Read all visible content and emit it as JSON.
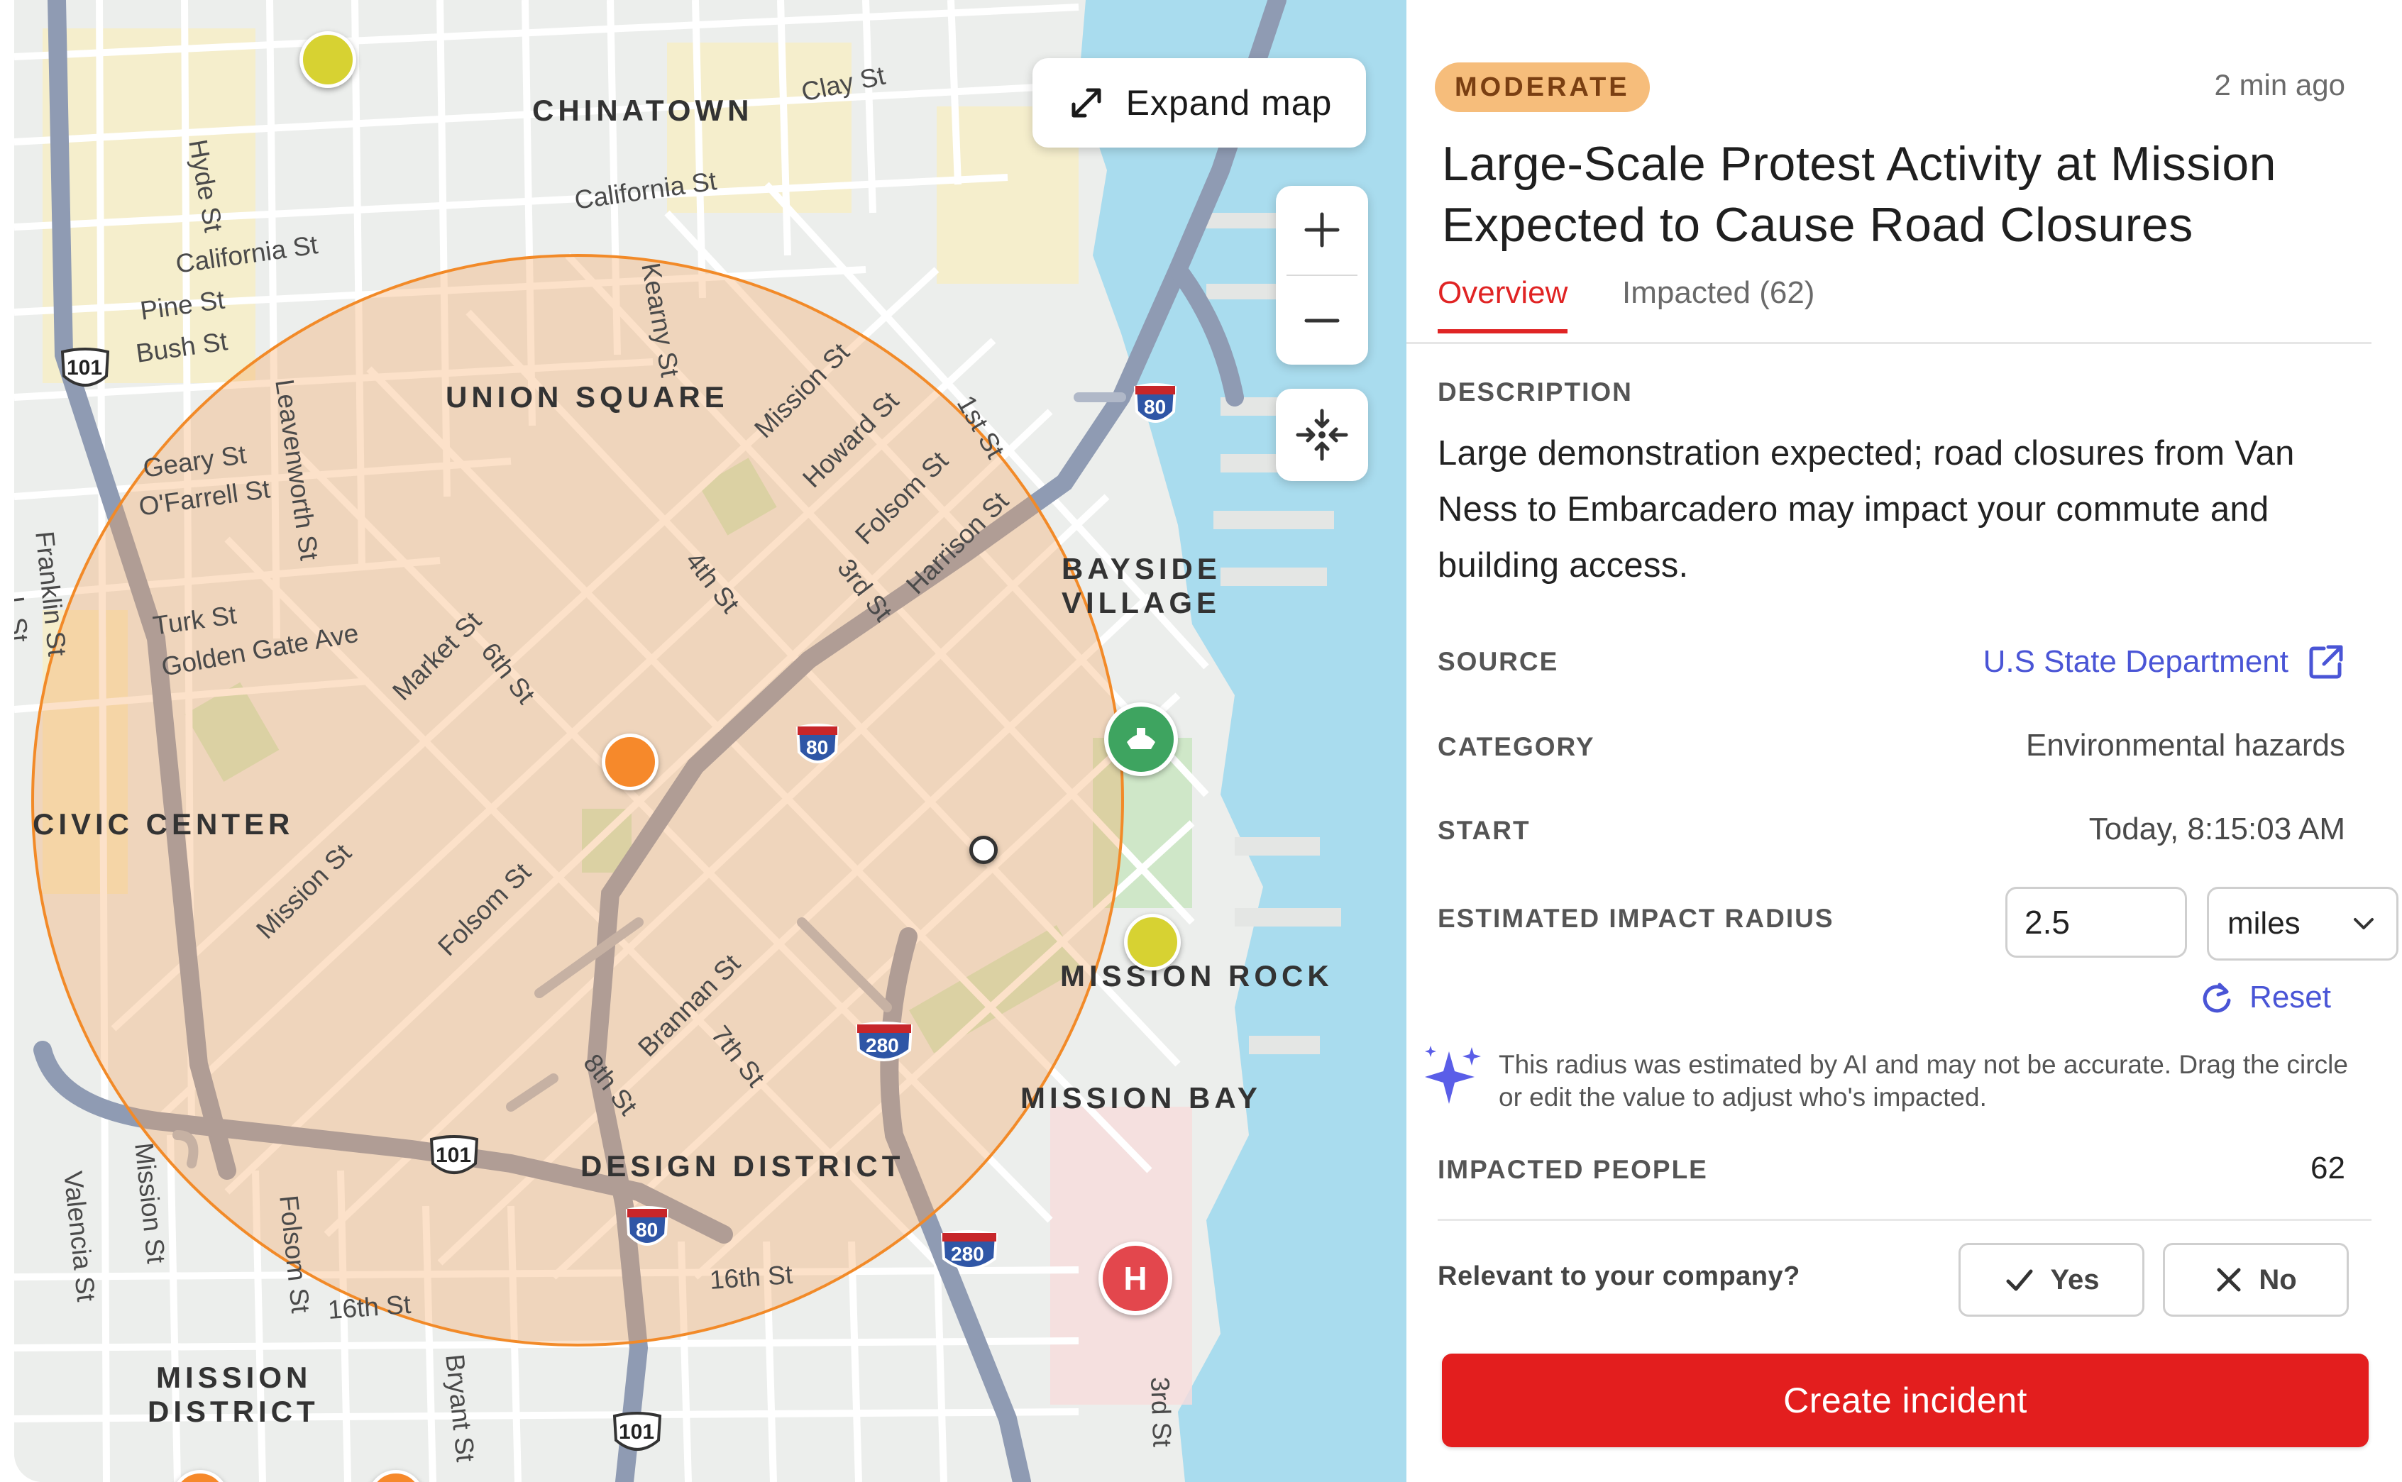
{
  "map": {
    "expand_label": "Expand map",
    "zoom_in": "+",
    "zoom_out": "−",
    "districts": {
      "chinatown": "CHINATOWN",
      "union_square": "UNION SQUARE",
      "bayside_1": "BAYSIDE",
      "bayside_2": "VILLAGE",
      "civic_center": "CIVIC CENTER",
      "mission_rock": "MISSION ROCK",
      "mission_bay": "MISSION BAY",
      "design_district": "DESIGN DISTRICT",
      "mission_district_1": "MISSION",
      "mission_district_2": "DISTRICT"
    },
    "streets": {
      "clay": "Clay St",
      "hyde": "Hyde St",
      "california_1": "California St",
      "california_2": "California St",
      "pine": "Pine St",
      "bush": "Bush St",
      "kearny": "Kearny St",
      "leavenworth": "Leavenworth St",
      "mission_1": "Mission St",
      "howard": "Howard St",
      "first": "1st St",
      "folsom_1": "Folsom St",
      "harrison": "Harrison St",
      "third_1": "3rd St",
      "fourth": "4th St",
      "geary": "Geary St",
      "ofarrell": "O'Farrell St",
      "franklin": "Franklin St",
      "turk": "Turk St",
      "golden_gate": "Golden Gate Ave",
      "market": "Market St",
      "sixth": "6th St",
      "mission_2": "Mission St",
      "folsom_2": "Folsom St",
      "brannan": "Brannan St",
      "seventh": "7th St",
      "eighth": "8th St",
      "mission_3": "Mission St",
      "valencia": "Valencia St",
      "folsom_3": "Folsom St",
      "sixteenth_1": "16th St",
      "sixteenth_2": "16th St",
      "bryant": "Bryant St",
      "third_2": "3rd St",
      "lt": "L St"
    },
    "shields": {
      "us101_a": "101",
      "us101_b": "101",
      "us101_c": "101",
      "i80_a": "80",
      "i80_b": "80",
      "i80_c": "80",
      "i280_a": "280",
      "i280_b": "280"
    },
    "hospital_letter": "H"
  },
  "panel": {
    "severity": "MODERATE",
    "timestamp": "2 min ago",
    "title": "Large-Scale Protest Activity at Mission Expected to Cause Road Closures",
    "tabs": {
      "overview": "Overview",
      "impacted": "Impacted (62)"
    },
    "description_label": "DESCRIPTION",
    "description": "Large demonstration expected; road closures from Van Ness to Embarcadero may impact your commute and building access.",
    "source_label": "SOURCE",
    "source_value": "U.S State Department",
    "category_label": "CATEGORY",
    "category_value": "Environmental hazards",
    "start_label": "START",
    "start_value": "Today, 8:15:03 AM",
    "radius_label": "ESTIMATED IMPACT RADIUS",
    "radius_value": "2.5",
    "radius_unit": "miles",
    "reset_label": "Reset",
    "ai_note": "This radius was estimated by AI and may not be accurate. Drag the circle or edit the value to adjust who's impacted.",
    "impacted_label": "IMPACTED PEOPLE",
    "impacted_value": "62",
    "relevant_label": "Relevant to your company?",
    "yes_label": "Yes",
    "no_label": "No",
    "create_label": "Create incident"
  },
  "colors": {
    "accent_red": "#e31e1e",
    "link_blue": "#4a55d6",
    "badge_bg": "#f6bd7b",
    "impact_circle": "#f39a3b",
    "water": "#a9dcee"
  }
}
